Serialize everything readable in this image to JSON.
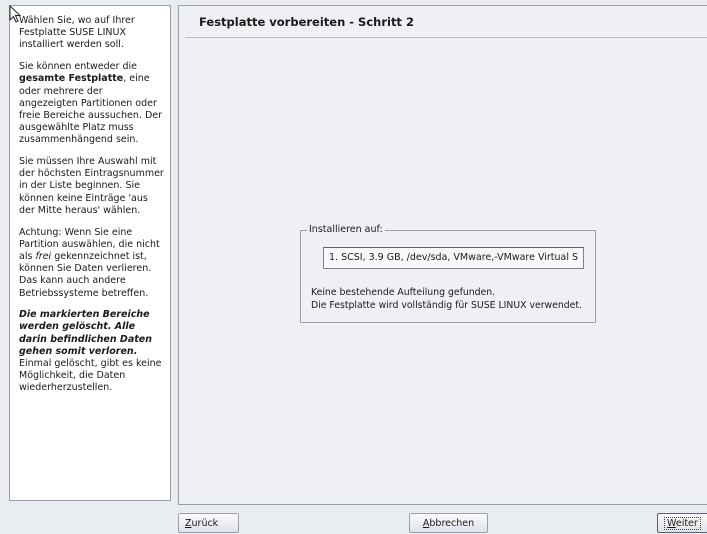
{
  "help": {
    "p1": "Wählen Sie, wo auf Ihrer Festplatte SUSE LINUX installiert werden soll.",
    "p2_a": "Sie können entweder die ",
    "p2_b": "gesamte Festplatte",
    "p2_c": ", eine oder mehrere der angezeigten Partitionen oder freie Bereiche aussuchen. Der ausgewählte Platz muss zusammenhängend sein.",
    "p3": "Sie müssen Ihre Auswahl mit der höchsten Eintragsnummer in der Liste beginnen. Sie können keine Einträge 'aus der Mitte heraus' wählen.",
    "p4_a": "Achtung: Wenn Sie eine Partition auswählen, die nicht als ",
    "p4_b": "frei",
    "p4_c": " gekennzeichnet ist, können Sie Daten verlieren. Das kann auch andere Betriebssysteme betreffen.",
    "p5_a": "Die markierten Bereiche werden gelöscht. Alle darin befindlichen Daten gehen somit verloren.",
    "p5_b": " Einmal gelöscht, gibt es keine Möglichkeit, die Daten wiederherzustellen."
  },
  "main": {
    "title": "Festplatte vorbereiten - Schritt 2",
    "install_group_label": "Installieren auf:",
    "disk_value": "1. SCSI,    3.9 GB, /dev/sda, VMware,-VMware Virtual S",
    "message_line1": "Keine bestehende Aufteilung gefunden.",
    "message_line2": "Die Festplatte wird vollständig für SUSE LINUX verwendet."
  },
  "buttons": {
    "back_mnemonic": "Z",
    "back_rest": "urück",
    "cancel_mnemonic": "A",
    "cancel_rest": "bbrechen",
    "next_mnemonic": "W",
    "next_rest": "eiter"
  }
}
